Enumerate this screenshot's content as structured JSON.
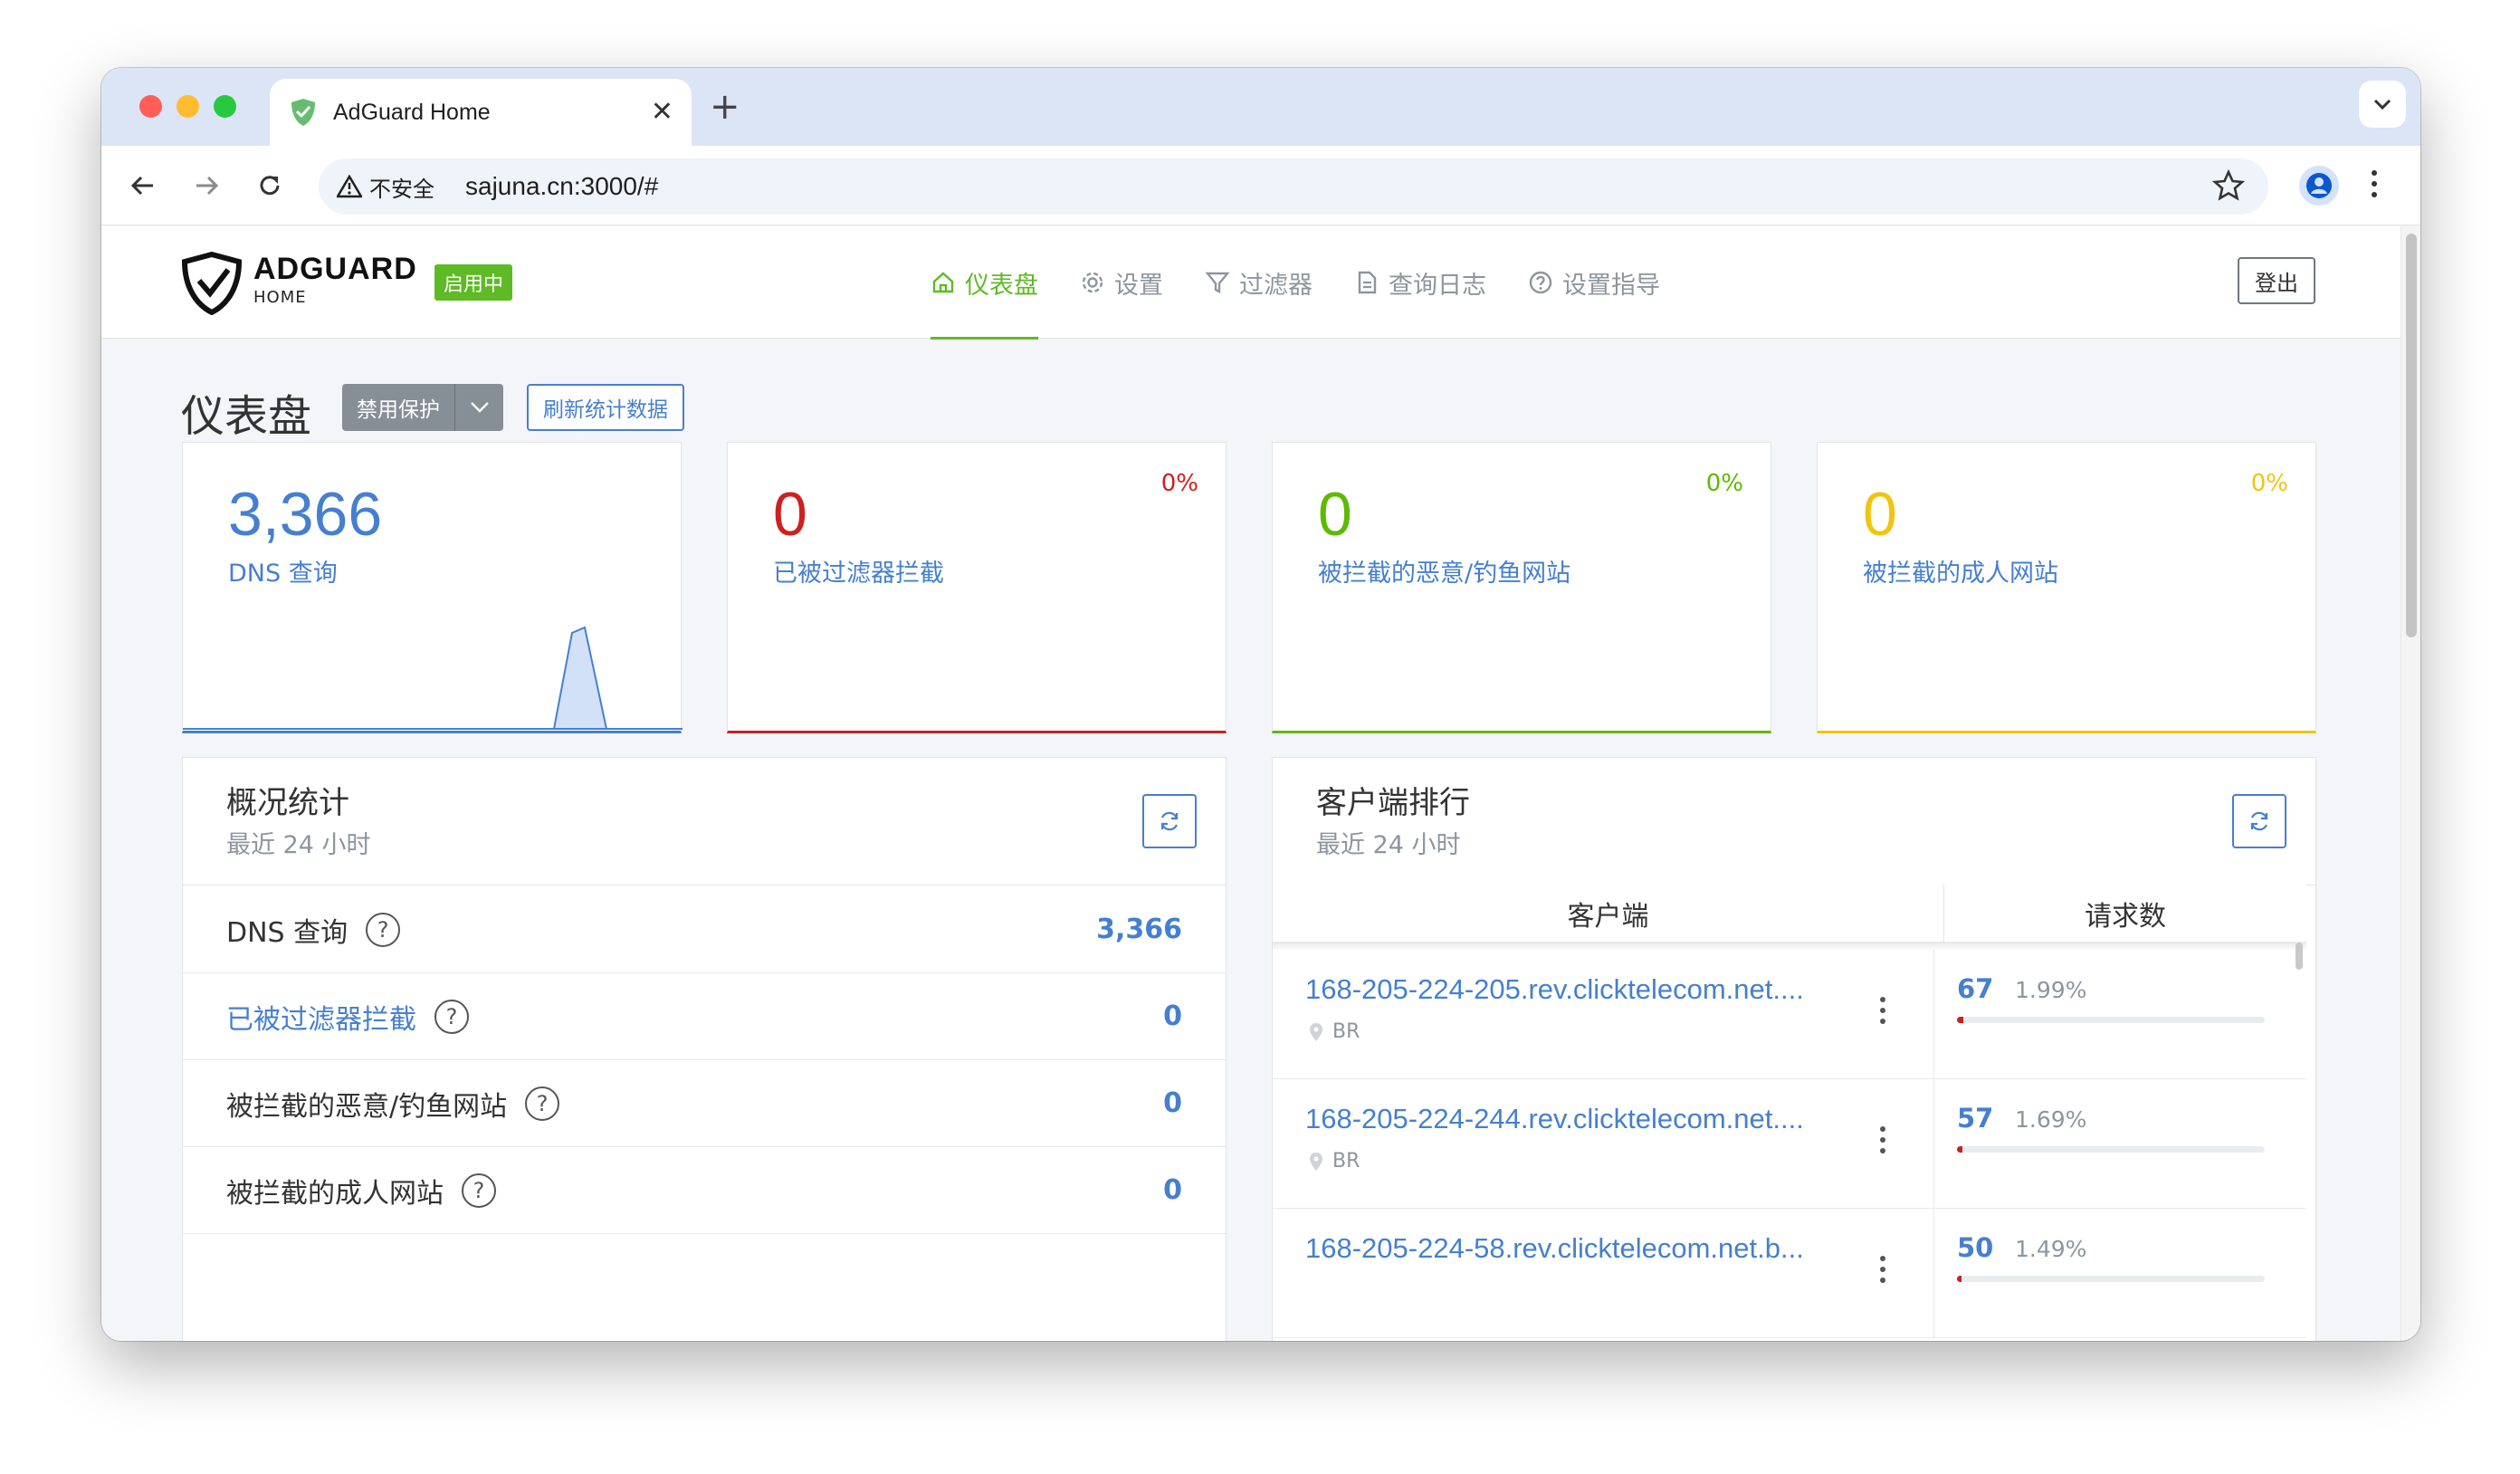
{
  "browser": {
    "tab_title": "AdGuard Home",
    "security_label": "不安全",
    "url": "sajuna.cn:3000/#",
    "colors": {
      "close": "#ff5f57",
      "minimize": "#febc2e",
      "maximize": "#28c840"
    }
  },
  "header": {
    "logo_main": "ADGUARD",
    "logo_sub": "HOME",
    "status_badge": "启用中",
    "nav": [
      {
        "label": "仪表盘",
        "icon": "home-icon",
        "active": true
      },
      {
        "label": "设置",
        "icon": "gear-icon"
      },
      {
        "label": "过滤器",
        "icon": "filter-icon"
      },
      {
        "label": "查询日志",
        "icon": "document-icon"
      },
      {
        "label": "设置指导",
        "icon": "help-circle-icon"
      }
    ],
    "logout_label": "登出"
  },
  "dashboard": {
    "title": "仪表盘",
    "disable_protection_label": "禁用保护",
    "refresh_stats_label": "刷新统计数据"
  },
  "stat_cards": [
    {
      "value": "3,366",
      "label": "DNS 查询",
      "percent": "",
      "color": "#467fcf"
    },
    {
      "value": "0",
      "label": "已被过滤器拦截",
      "percent": "0%",
      "color": "#cd201f"
    },
    {
      "value": "0",
      "label": "被拦截的恶意/钓鱼网站",
      "percent": "0%",
      "color": "#5eba00"
    },
    {
      "value": "0",
      "label": "被拦截的成人网站",
      "percent": "0%",
      "color": "#f1c40f"
    }
  ],
  "general_stats": {
    "title": "概况统计",
    "subtitle": "最近 24 小时",
    "rows": [
      {
        "label": "DNS 查询",
        "value": "3,366"
      },
      {
        "label": "已被过滤器拦截",
        "value": "0"
      },
      {
        "label": "被拦截的恶意/钓鱼网站",
        "value": "0"
      },
      {
        "label": "被拦截的成人网站",
        "value": "0"
      }
    ]
  },
  "top_clients": {
    "title": "客户端排行",
    "subtitle": "最近 24 小时",
    "col_client": "客户端",
    "col_requests": "请求数",
    "rows": [
      {
        "name": "168-205-224-205.rev.clicktelecom.net....",
        "country": "BR",
        "count": "67",
        "percent": "1.99%",
        "fraction": 0.0199
      },
      {
        "name": "168-205-224-244.rev.clicktelecom.net....",
        "country": "BR",
        "count": "57",
        "percent": "1.69%",
        "fraction": 0.0169
      },
      {
        "name": "168-205-224-58.rev.clicktelecom.net.b...",
        "country": "",
        "count": "50",
        "percent": "1.49%",
        "fraction": 0.0149
      }
    ]
  }
}
